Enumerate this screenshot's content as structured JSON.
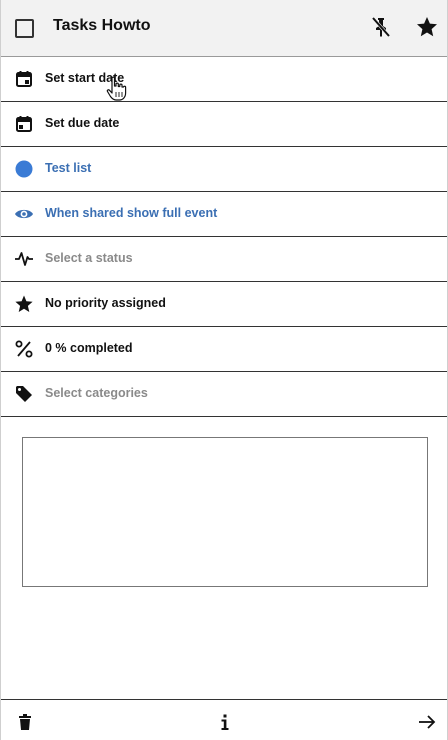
{
  "header": {
    "title": "Tasks Howto",
    "icons": [
      "checkbox-icon",
      "pin-off-icon",
      "star-icon"
    ]
  },
  "rows": [
    {
      "label": "Set start date",
      "icon": "calendar-start-icon"
    },
    {
      "label": "Set due date",
      "icon": "calendar-due-icon"
    },
    {
      "label": "Test list",
      "icon": "list-color-dot-icon"
    },
    {
      "label": "When shared show full event",
      "icon": "eye-icon"
    },
    {
      "label": "Select a status",
      "icon": "status-pulse-icon"
    },
    {
      "label": "No priority assigned",
      "icon": "star-icon"
    },
    {
      "label": "0 % completed",
      "icon": "percent-icon"
    },
    {
      "label": "Select categories",
      "icon": "tag-icon"
    }
  ],
  "notes": {
    "value": ""
  },
  "footer": {
    "icons": [
      "trash-icon",
      "info-icon",
      "arrow-right-icon"
    ]
  },
  "colors": {
    "list_color": "#3a7bd5",
    "link_text": "#3b6fb3",
    "placeholder_text": "#8a8a8a"
  }
}
